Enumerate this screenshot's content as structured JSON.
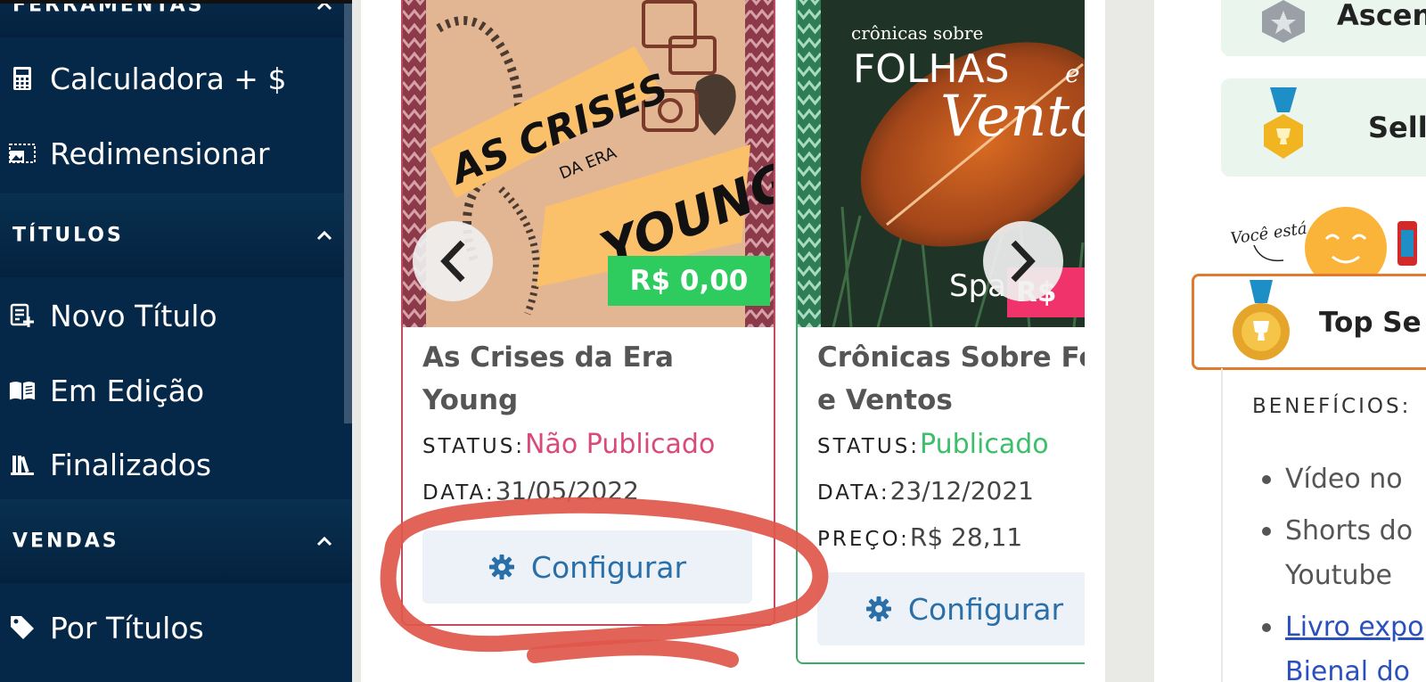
{
  "sidebar": {
    "sections": [
      {
        "label": "FERRAMENTAS"
      },
      {
        "label": "TÍTULOS"
      },
      {
        "label": "VENDAS"
      }
    ],
    "items": [
      {
        "label": "Calculadora + $",
        "icon": "calculator-icon"
      },
      {
        "label": "Redimensionar",
        "icon": "resize-image-icon"
      },
      {
        "label": "Novo Título",
        "icon": "new-title-icon"
      },
      {
        "label": "Em Edição",
        "icon": "open-book-icon"
      },
      {
        "label": "Finalizados",
        "icon": "library-icon"
      },
      {
        "label": "Por Títulos",
        "icon": "tag-icon"
      }
    ]
  },
  "books": [
    {
      "title": "As Crises da Era Young",
      "cover_text": {
        "line1": "AS CRISES",
        "line2": "DA ERA",
        "line3": "YOUNG"
      },
      "price_badge": "R$ 0,00",
      "status_label": "STATUS:",
      "status_value": "Não Publicado",
      "date_label": "DATA:",
      "date_value": "31/05/2022",
      "configure_label": "Configurar",
      "border_color": "#c64a5d"
    },
    {
      "title": "Crônicas Sobre Folhas e Ventos",
      "title_visible_line1": "Crônicas Sobre Fo",
      "title_visible_line2": "e Ventos",
      "cover_text": {
        "line1": "crônicas sobre",
        "line2": "FOLHAS",
        "line3": "Vento",
        "author": "Spa",
        "e": "e"
      },
      "price_badge": "R$",
      "status_label": "STATUS:",
      "status_value": "Publicado",
      "date_label": "DATA:",
      "date_value": "23/12/2021",
      "price_label": "PREÇO:",
      "price_value": "R$ 28,11",
      "configure_label": "Configurar",
      "border_color": "#3cab6a"
    }
  ],
  "right_panel": {
    "levels": [
      {
        "name": "Ascen",
        "icon": "silver-badge-icon"
      },
      {
        "name": "Sell",
        "icon": "gold-medal-icon"
      }
    ],
    "you_are_here": "Você está aqui!",
    "current_level": {
      "name": "Top Se",
      "icon": "trophy-medal-icon"
    },
    "benefits_title": "BENEFÍCIOS:",
    "benefits": [
      {
        "text": "Vídeo no ",
        "link": false
      },
      {
        "text": "Shorts do",
        "text2": "Youtube",
        "link": false
      },
      {
        "text": "Livro expo",
        "text2": "Bienal do",
        "link": true
      }
    ]
  },
  "colors": {
    "sidebar_bg": "#062848",
    "status_unpublished": "#d94a7a",
    "status_published": "#3bbf6a",
    "configure_text": "#2a6fa8",
    "price_badge_green": "#2ecc5f",
    "price_badge_pink": "#f0336b",
    "annotation_red": "#e0574a"
  }
}
